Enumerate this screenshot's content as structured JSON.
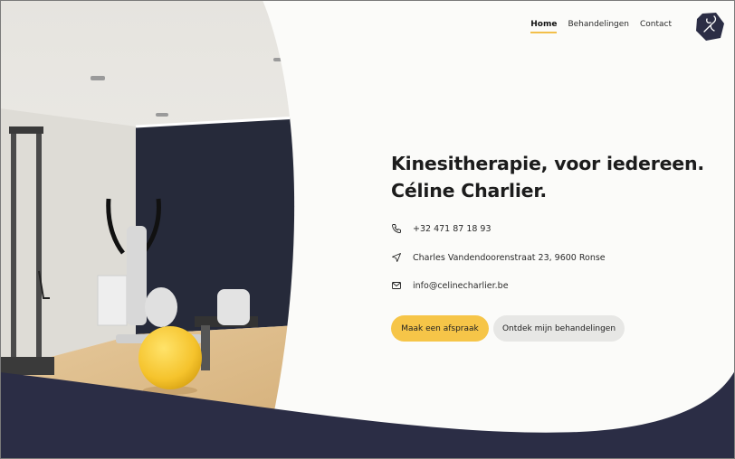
{
  "nav": {
    "items": [
      {
        "label": "Home",
        "active": true
      },
      {
        "label": "Behandelingen",
        "active": false
      },
      {
        "label": "Contact",
        "active": false
      }
    ]
  },
  "hero": {
    "title_line1": "Kinesitherapie, voor iedereen.",
    "title_line2": "Céline Charlier."
  },
  "contact": {
    "phone": "+32 471 87 18 93",
    "address": "Charles Vandendoorenstraat 23, 9600 Ronse",
    "email": "info@celinecharlier.be"
  },
  "buttons": {
    "primary": "Maak een afspraak",
    "secondary": "Ontdek mijn behandelingen"
  },
  "colors": {
    "accent": "#f6c548",
    "navy": "#2b2d45",
    "background": "#fbfbf9"
  },
  "icons": [
    "phone-icon",
    "location-arrow-icon",
    "mail-icon",
    "logo-icon"
  ]
}
